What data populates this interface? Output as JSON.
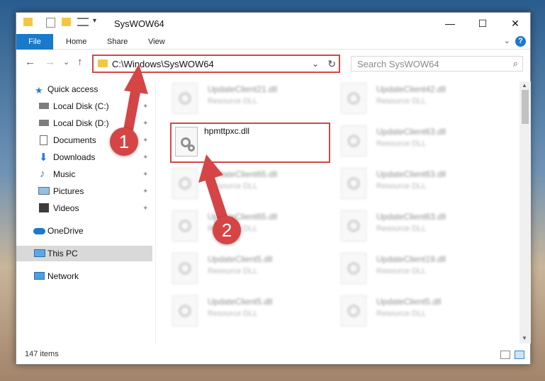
{
  "window": {
    "title": "SysWOW64",
    "controls": {
      "minimize": "—",
      "maximize": "☐",
      "close": "✕"
    }
  },
  "ribbon": {
    "file_tab": "File",
    "tabs": [
      "Home",
      "Share",
      "View"
    ],
    "help": "?",
    "chevron": "⌄"
  },
  "navigation": {
    "back": "←",
    "forward": "→",
    "recent": "⌄",
    "up": "↑",
    "address": "C:\\Windows\\SysWOW64",
    "address_chevron": "⌄",
    "refresh": "↻",
    "search_placeholder": "Search SysWOW64",
    "search_icon": "⌕"
  },
  "sidebar": {
    "items": [
      {
        "label": "Quick access",
        "icon": "star-icon",
        "pinned": false
      },
      {
        "label": "Local Disk (C:)",
        "icon": "drive-icon",
        "pinned": true
      },
      {
        "label": "Local Disk (D:)",
        "icon": "drive-icon",
        "pinned": true
      },
      {
        "label": "Documents",
        "icon": "documents-icon",
        "pinned": true
      },
      {
        "label": "Downloads",
        "icon": "download-icon",
        "pinned": true
      },
      {
        "label": "Music",
        "icon": "music-icon",
        "pinned": true
      },
      {
        "label": "Pictures",
        "icon": "pictures-icon",
        "pinned": true
      },
      {
        "label": "Videos",
        "icon": "videos-icon",
        "pinned": true
      },
      {
        "label": "OneDrive",
        "icon": "cloud-icon",
        "pinned": false
      },
      {
        "label": "This PC",
        "icon": "computer-icon",
        "pinned": false,
        "selected": true
      },
      {
        "label": "Network",
        "icon": "network-icon",
        "pinned": false
      }
    ],
    "pin_glyph": "📌"
  },
  "files": {
    "highlighted": "hpmttpxc.dll",
    "left_column": [
      {
        "name": "UpdateClient21.dll",
        "type": "Resource DLL"
      },
      {
        "name": "UpdateClient65.dll",
        "type": "Resource DLL"
      },
      {
        "name": "UpdateClient65.dll",
        "type": "Resource DLL"
      },
      {
        "name": "UpdateClient5.dll",
        "type": "Resource DLL"
      },
      {
        "name": "UpdateClient5.dll",
        "type": "Resource DLL"
      }
    ],
    "right_column": [
      {
        "name": "UpdateClient42.dll",
        "type": "Resource DLL"
      },
      {
        "name": "UpdateClient63.dll",
        "type": "Resource DLL"
      },
      {
        "name": "UpdateClient63.dll",
        "type": "Resource DLL"
      },
      {
        "name": "UpdateClient63.dll",
        "type": "Resource DLL"
      },
      {
        "name": "UpdateClient19.dll",
        "type": "Resource DLL"
      },
      {
        "name": "UpdateClient5.dll",
        "type": "Resource DLL"
      }
    ]
  },
  "status": {
    "item_count": "147 items"
  },
  "annotations": {
    "step1": "1",
    "step2": "2",
    "color": "#d64545"
  }
}
